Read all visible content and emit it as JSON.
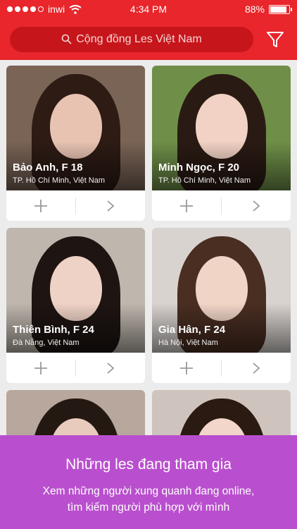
{
  "status_bar": {
    "carrier": "inwi",
    "time": "4:34 PM",
    "battery": "88%",
    "battery_level": 0.88
  },
  "header": {
    "search_placeholder": "Cộng đồng Les Việt Nam"
  },
  "profiles": [
    {
      "name": "Bảo Anh, F 18",
      "location": "TP. Hồ Chí Minh, Việt Nam",
      "bg": "#7a6456",
      "hair": "#2d1b14",
      "skin": "#e8c3b2"
    },
    {
      "name": "Minh Ngọc, F 20",
      "location": "TP. Hồ Chí Minh, Việt Nam",
      "bg": "#6f8f48",
      "hair": "#2a1a14",
      "skin": "#f1d2c4"
    },
    {
      "name": "Thiên Bình, F 24",
      "location": "Đà Nẵng, Việt Nam",
      "bg": "#bfb7ae",
      "hair": "#1e1512",
      "skin": "#eed2c5"
    },
    {
      "name": "Gia Hân, F 24",
      "location": "Hà Nội, Việt Nam",
      "bg": "#d9d3cf",
      "hair": "#4a2e22",
      "skin": "#f0d4c6"
    },
    {
      "name": "",
      "location": "",
      "bg": "#b7a79c",
      "hair": "#241812",
      "skin": "#e9cbbd"
    },
    {
      "name": "",
      "location": "",
      "bg": "#cfc4bd",
      "hair": "#2a1a12",
      "skin": "#f2d6ca"
    }
  ],
  "banner": {
    "title": "Những les đang tham gia",
    "line1": "Xem những người xung quanh đang online,",
    "line2": "tìm kiếm người phù hợp với mình"
  },
  "colors": {
    "header": "#e8262b",
    "search": "#c7161b",
    "banner": "#b94fce"
  }
}
